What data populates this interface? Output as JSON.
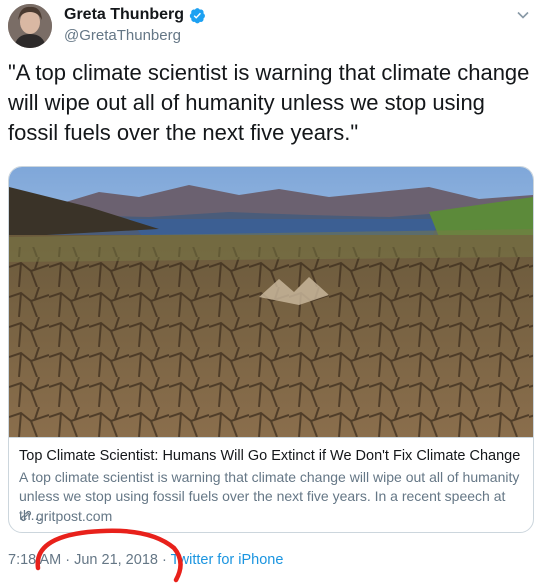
{
  "header": {
    "name": "Greta Thunberg",
    "handle": "@GretaThunberg",
    "verified_icon": "verified-badge-icon",
    "menu_icon": "chevron-down-icon"
  },
  "tweet": {
    "text": "\"A top climate scientist is warning that climate change will wipe out all of humanity unless we stop using fossil fuels over the next five years.\""
  },
  "card": {
    "title": "Top Climate Scientist: Humans Will Go Extinct if We Don't Fix Climate Change by ...",
    "description": "A top climate scientist is warning that climate change will wipe out all of humanity unless we stop using fossil fuels over the next five years. In a recent speech at th...",
    "domain": "gritpost.com",
    "link_icon": "link-icon"
  },
  "meta": {
    "time": "7:18 AM",
    "separator": " · ",
    "date": "Jun 21, 2018",
    "source": "Twitter for iPhone"
  },
  "colors": {
    "accent": "#1b95e0",
    "secondary_text": "#657786",
    "annotation": "#e8211b"
  }
}
